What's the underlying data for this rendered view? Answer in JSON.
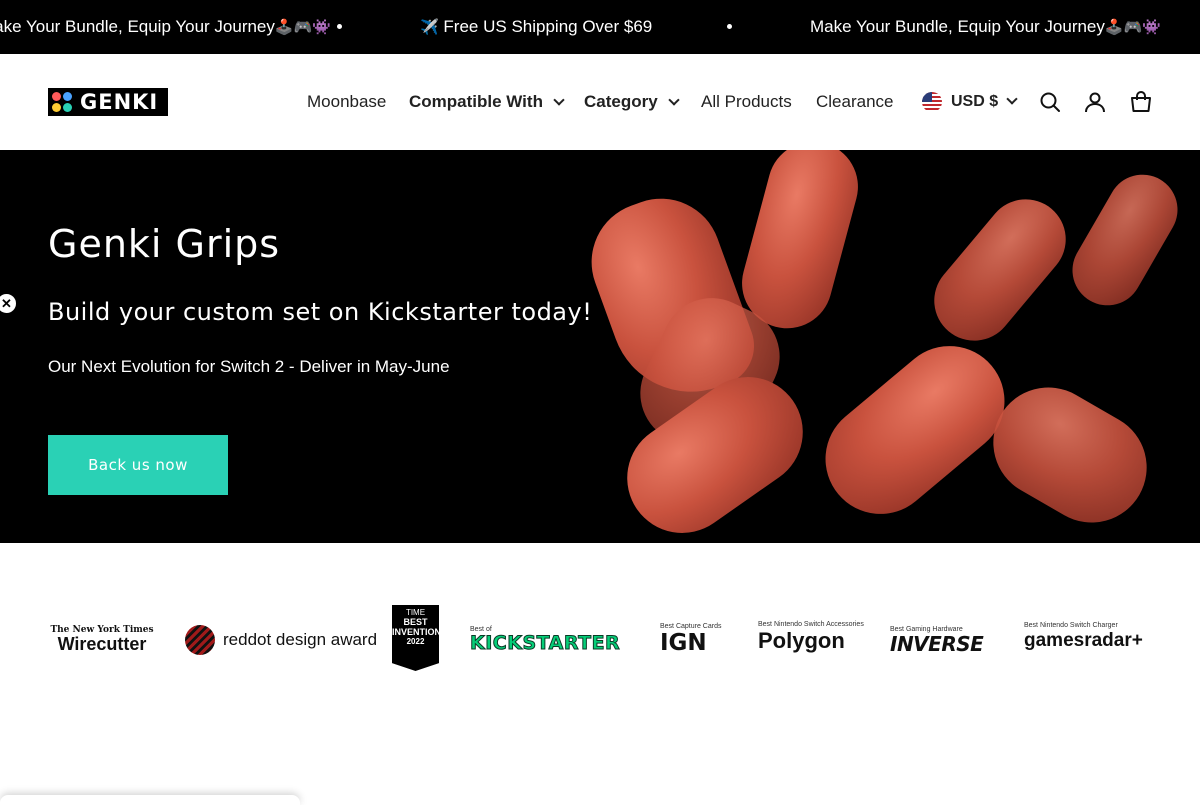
{
  "announcement": {
    "items": [
      {
        "text": "Make Your Bundle, Equip Your Journey",
        "emoji": "🕹️🎮👾"
      },
      {
        "text": "Free US Shipping Over $69",
        "emoji": "✈️"
      },
      {
        "text": "Make Your Bundle, Equip Your Journey",
        "emoji": "🕹️🎮👾"
      }
    ]
  },
  "header": {
    "logo_text": "GENKI",
    "nav": [
      {
        "label": "Moonbase"
      },
      {
        "label": "Compatible With"
      },
      {
        "label": "Category"
      },
      {
        "label": "All Products"
      },
      {
        "label": "Clearance"
      }
    ],
    "currency": "USD $",
    "icons": [
      "search-icon",
      "account-icon",
      "cart-icon"
    ]
  },
  "hero": {
    "title": "Genki Grips",
    "subtitle": "Build your custom set on Kickstarter today!",
    "description": "Our Next Evolution for Switch 2 - Deliver in May-June",
    "cta": "Back us now",
    "close_symbol": "✕",
    "accent_color": "#2ad1b5"
  },
  "press": {
    "logos": [
      {
        "top": "The New York Times",
        "main": "Wirecutter"
      },
      {
        "main": "reddot design award"
      },
      {
        "top": "TIME",
        "main": "BEST INVENTIONS",
        "year": "2022"
      },
      {
        "top": "Best of",
        "main": "KICKSTARTER"
      },
      {
        "top": "Best Capture Cards",
        "main": "IGN"
      },
      {
        "top": "Best Nintendo Switch Accessories",
        "main": "Polygon"
      },
      {
        "top": "Best Gaming Hardware",
        "main": "INVERSE"
      },
      {
        "top": "Best Nintendo Switch Charger",
        "main": "gamesradar+"
      }
    ]
  }
}
